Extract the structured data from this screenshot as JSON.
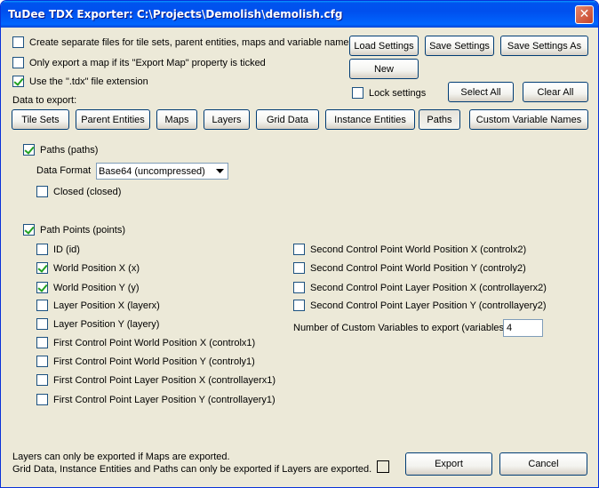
{
  "window": {
    "title": "TuDee TDX Exporter: C:\\Projects\\Demolish\\demolish.cfg",
    "close_glyph": "✕"
  },
  "options": {
    "separate_files": {
      "label": "Create separate files for tile sets, parent entities, maps and variable names",
      "checked": false
    },
    "export_map_only": {
      "label": "Only export a map if its \"Export Map\" property is ticked",
      "checked": false
    },
    "tdx_extension": {
      "label": "Use the \".tdx\" file extension",
      "checked": true
    }
  },
  "settings_buttons": {
    "load": "Load Settings",
    "save": "Save Settings",
    "save_as": "Save Settings As",
    "new": "New",
    "lock": {
      "label": "Lock settings",
      "checked": false
    },
    "select_all": "Select All",
    "clear_all": "Clear All"
  },
  "data_to_export_label": "Data to export:",
  "tabs": [
    "Tile Sets",
    "Parent Entities",
    "Maps",
    "Layers",
    "Grid Data",
    "Instance Entities",
    "Paths",
    "Custom Variable Names"
  ],
  "active_tab": "Paths",
  "paths_section": {
    "paths": {
      "label": "Paths (paths)",
      "checked": true
    },
    "data_format_label": "Data Format",
    "data_format_value": "Base64 (uncompressed)",
    "closed": {
      "label": "Closed (closed)",
      "checked": false
    }
  },
  "points_section": {
    "points": {
      "label": "Path Points (points)",
      "checked": true
    },
    "left": [
      {
        "label": "ID (id)",
        "checked": false
      },
      {
        "label": "World Position X (x)",
        "checked": true
      },
      {
        "label": "World Position Y (y)",
        "checked": true
      },
      {
        "label": "Layer Position X (layerx)",
        "checked": false
      },
      {
        "label": "Layer Position Y (layery)",
        "checked": false
      },
      {
        "label": "First Control Point World Position X (controlx1)",
        "checked": false
      },
      {
        "label": "First Control Point World Position Y (controly1)",
        "checked": false
      },
      {
        "label": "First Control Point Layer Position X (controllayerx1)",
        "checked": false
      },
      {
        "label": "First Control Point Layer Position Y (controllayery1)",
        "checked": false
      }
    ],
    "right": [
      {
        "label": "Second Control Point World Position X (controlx2)",
        "checked": false
      },
      {
        "label": "Second Control Point World Position Y (controly2)",
        "checked": false
      },
      {
        "label": "Second Control Point Layer Position X (controllayerx2)",
        "checked": false
      },
      {
        "label": "Second Control Point Layer Position Y (controllayery2)",
        "checked": false
      }
    ],
    "custom_vars_label": "Number of Custom Variables to export (variables)",
    "custom_vars_value": "4"
  },
  "footer": {
    "note1": "Layers can only be exported if Maps are exported.",
    "note2": "Grid Data, Instance Entities and Paths can only be exported if Layers are exported.",
    "export": "Export",
    "cancel": "Cancel"
  }
}
